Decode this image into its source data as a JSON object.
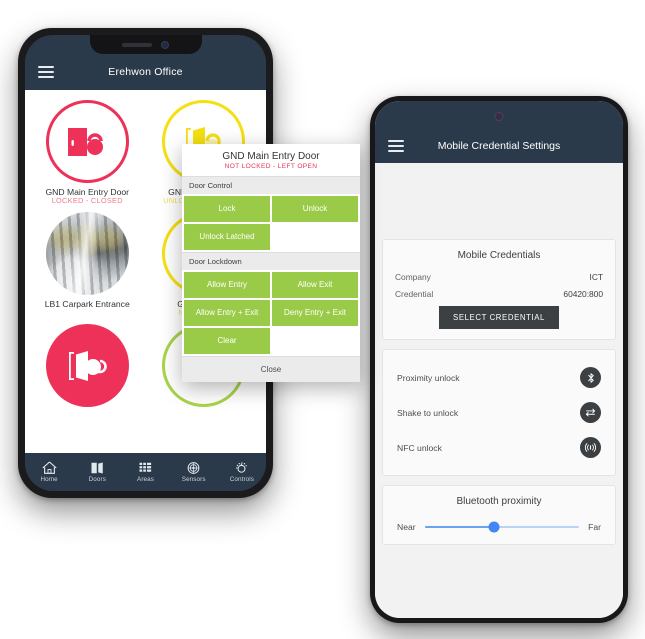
{
  "phone_left": {
    "appbar": {
      "title": "Erehwon Office",
      "menu_icon": "hamburger-icon"
    },
    "tiles": [
      {
        "name": "GND Main Entry Door",
        "status": "LOCKED - CLOSED",
        "state": "locked-closed",
        "style": "outline-red",
        "icon": "door-closed-locked-icon"
      },
      {
        "name": "GND Service Door",
        "status": "UNLOCKED LATCHED",
        "state": "unlocked-latched",
        "style": "outline-yellow",
        "icon": "door-open-unlocked-icon"
      },
      {
        "name": "LB1 Carpark Entrance",
        "status": "",
        "state": "photo",
        "style": "photo",
        "icon": "carpark-photo-icon"
      },
      {
        "name": "GND Fire Exit",
        "status": "NOT LOCKED",
        "state": "not-locked",
        "style": "outline-yellow",
        "icon": "door-open-unlocked-icon"
      },
      {
        "name": "",
        "status": "",
        "state": "locked",
        "style": "fill-red",
        "icon": "door-open-locked-icon"
      },
      {
        "name": "",
        "status": "",
        "state": "unlocked",
        "style": "outline-green",
        "icon": "door-open-unlocked-icon"
      }
    ],
    "nav": [
      {
        "label": "Home",
        "icon": "home-icon"
      },
      {
        "label": "Doors",
        "icon": "doors-icon"
      },
      {
        "label": "Areas",
        "icon": "areas-grid-icon"
      },
      {
        "label": "Sensors",
        "icon": "sensors-radar-icon"
      },
      {
        "label": "Controls",
        "icon": "controls-dial-icon"
      }
    ]
  },
  "dialog": {
    "title": "GND Main Entry Door",
    "subtitle": "NOT LOCKED - LEFT OPEN",
    "sections": [
      {
        "header": "Door Control",
        "buttons": [
          "Lock",
          "Unlock",
          "Unlock Latched"
        ]
      },
      {
        "header": "Door Lockdown",
        "buttons": [
          "Allow Entry",
          "Allow Exit",
          "Allow Entry + Exit",
          "Deny Entry + Exit",
          "Clear"
        ]
      }
    ],
    "close_label": "Close"
  },
  "phone_right": {
    "appbar": {
      "title": "Mobile Credential Settings",
      "menu_icon": "hamburger-icon"
    },
    "credentials_card": {
      "title": "Mobile Credentials",
      "rows": [
        {
          "key": "Company",
          "value": "ICT"
        },
        {
          "key": "Credential",
          "value": "60420:800"
        }
      ],
      "button_label": "SELECT CREDENTIAL"
    },
    "unlock_options": [
      {
        "label": "Proximity unlock",
        "icon": "bluetooth-icon"
      },
      {
        "label": "Shake to unlock",
        "icon": "shake-arrows-icon"
      },
      {
        "label": "NFC unlock",
        "icon": "nfc-waves-icon"
      }
    ],
    "proximity_card": {
      "title": "Bluetooth proximity",
      "min_label": "Near",
      "max_label": "Far",
      "value_percent": 45
    }
  },
  "colors": {
    "navy": "#2b3a4a",
    "red": "#ee3158",
    "yellow": "#f5e011",
    "green": "#9acb48",
    "lime": "#a8d44a",
    "dark": "#3c4043",
    "slider_blue": "#4285f4"
  }
}
